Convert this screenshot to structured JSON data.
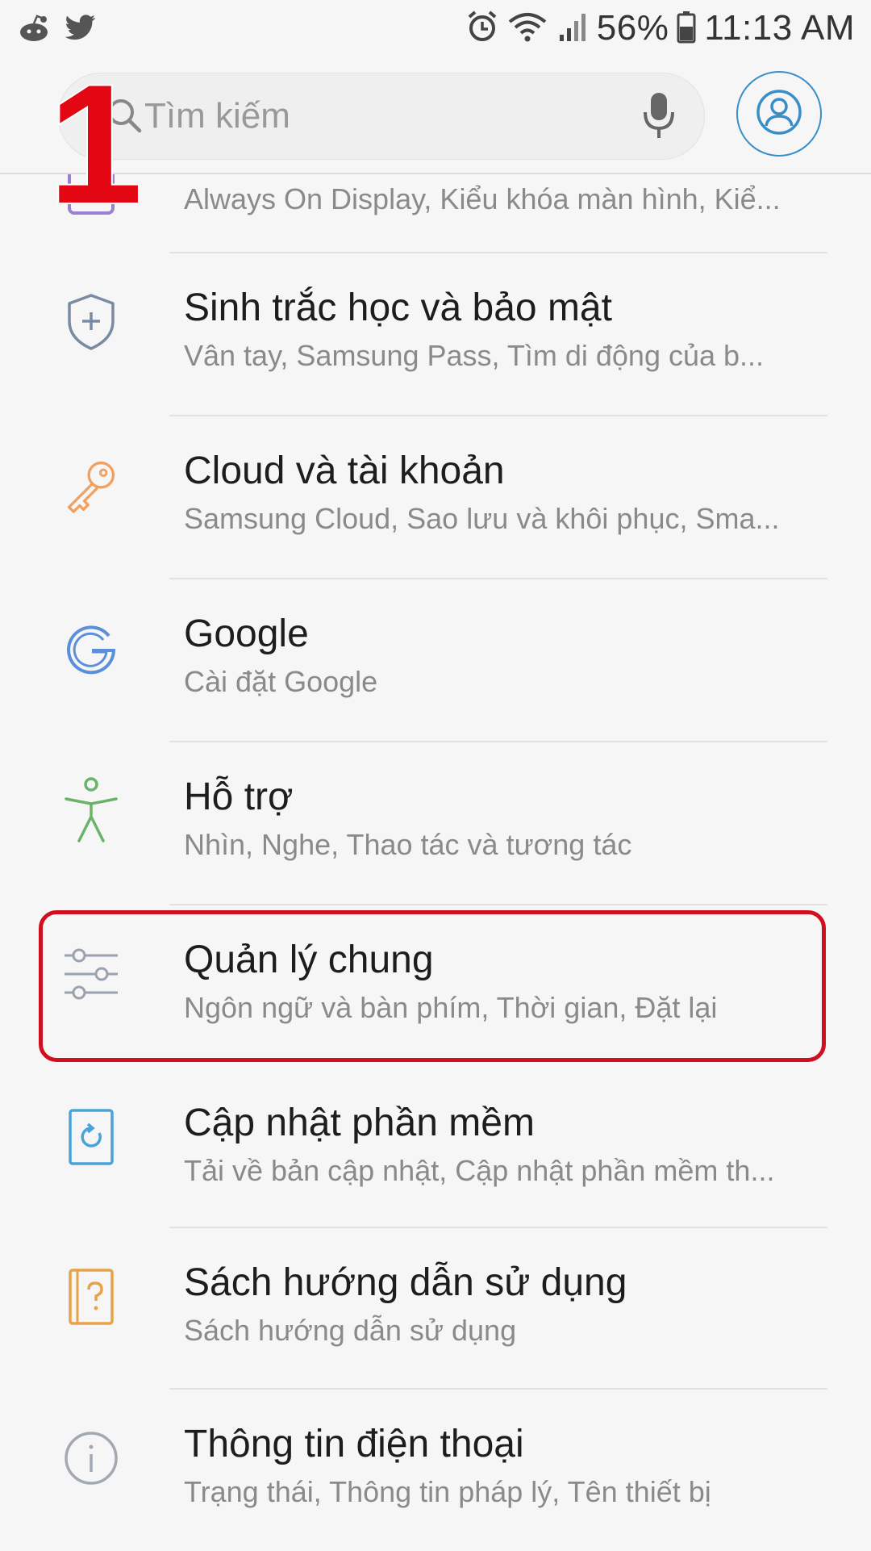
{
  "status_bar": {
    "battery": "56%",
    "time": "11:13 AM"
  },
  "search": {
    "placeholder": "Tìm kiếm"
  },
  "annotation": {
    "step_number": "1"
  },
  "partial_item": {
    "subtitle": "Always On Display, Kiểu khóa màn hình, Kiể..."
  },
  "items": [
    {
      "title": "Sinh trắc học và bảo mật",
      "subtitle": "Vân tay, Samsung Pass, Tìm di động của b...",
      "icon": "shield-plus-icon",
      "color": "#7b8aa3"
    },
    {
      "title": "Cloud và tài khoản",
      "subtitle": "Samsung Cloud, Sao lưu và khôi phục, Sma...",
      "icon": "key-icon",
      "color": "#f0a060"
    },
    {
      "title": "Google",
      "subtitle": "Cài đặt Google",
      "icon": "google-icon",
      "color": "#5b8fd9"
    },
    {
      "title": "Hỗ trợ",
      "subtitle": "Nhìn, Nghe, Thao tác và tương tác",
      "icon": "accessibility-icon",
      "color": "#6bb36b"
    },
    {
      "title": "Quản lý chung",
      "subtitle": "Ngôn ngữ và bàn phím, Thời gian, Đặt lại",
      "icon": "sliders-icon",
      "color": "#9aa3ad"
    },
    {
      "title": "Cập nhật phần mềm",
      "subtitle": "Tải về bản cập nhật, Cập nhật phần mềm th...",
      "icon": "software-update-icon",
      "color": "#4aa3d8"
    },
    {
      "title": "Sách hướng dẫn sử dụng",
      "subtitle": "Sách hướng dẫn sử dụng",
      "icon": "help-book-icon",
      "color": "#e8a24a"
    },
    {
      "title": "Thông tin điện thoại",
      "subtitle": "Trạng thái, Thông tin pháp lý, Tên thiết bị",
      "icon": "info-icon",
      "color": "#a3a9b0"
    }
  ]
}
